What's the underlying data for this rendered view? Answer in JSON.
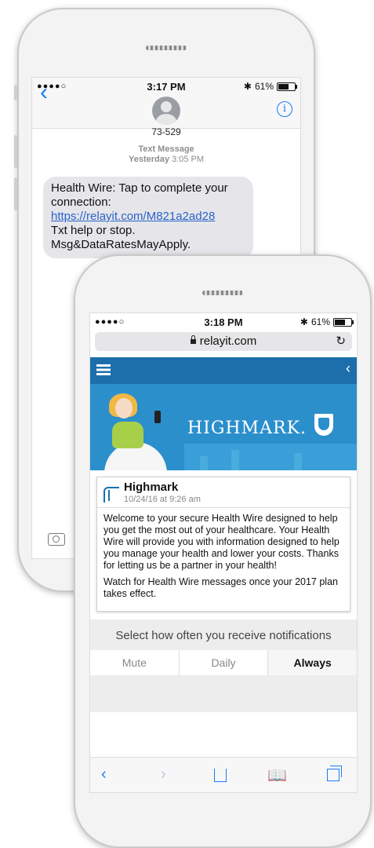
{
  "back_phone": {
    "status": {
      "signal": "●●●●○",
      "time": "3:17 PM",
      "battery": "61%"
    },
    "header": {
      "contact": "73-529",
      "info_glyph": "i"
    },
    "meta": {
      "label": "Text Message",
      "day": "Yesterday",
      "time": "3:05 PM"
    },
    "message": {
      "line1": "Health Wire: Tap to complete your connection:",
      "link": "https://relayit.com/M821a2ad28",
      "line2": "Txt help or stop.",
      "line3": "Msg&DataRatesMayApply."
    }
  },
  "front_phone": {
    "status": {
      "signal": "●●●●○",
      "time": "3:18 PM",
      "battery": "61%"
    },
    "url": "relayit.com",
    "banner": {
      "logo_text": "HIGHMARK."
    },
    "card": {
      "title": "Highmark",
      "date": "10/24/16 at 9:26 am",
      "para1": "Welcome to your secure Health Wire designed to help you get the most out of your healthcare. Your Health Wire will provide you with information designed to help you manage your health and lower your costs. Thanks for letting us be a partner in your health!",
      "para2": "Watch for Health Wire messages once your 2017 plan takes effect."
    },
    "notifications": {
      "label": "Select how often you receive notifications",
      "options": [
        "Mute",
        "Daily",
        "Always"
      ],
      "selected": "Always"
    }
  }
}
